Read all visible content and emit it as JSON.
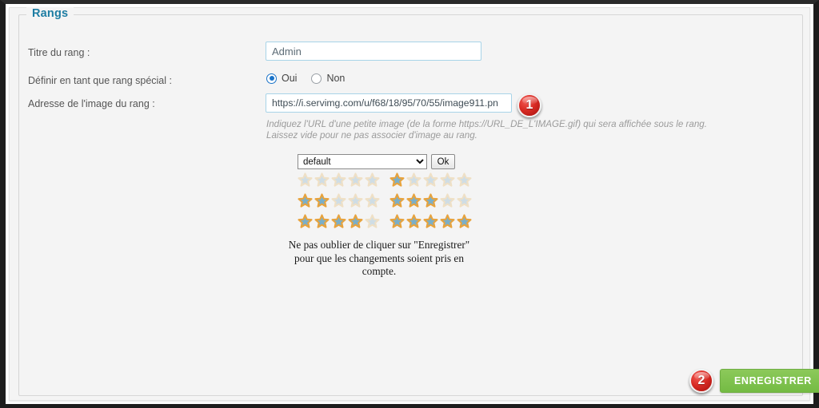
{
  "panel": {
    "legend": "Rangs"
  },
  "fields": {
    "title": {
      "label": "Titre du rang :",
      "value": "Admin",
      "placeholder": ""
    },
    "special": {
      "label": "Définir en tant que rang spécial :",
      "options": [
        {
          "label": "Oui",
          "selected": true
        },
        {
          "label": "Non",
          "selected": false
        }
      ]
    },
    "image": {
      "label": "Adresse de l'image du rang :",
      "value": "https://i.servimg.com/u/f68/18/95/70/55/image911.pn",
      "placeholder": "",
      "hint_line1": "Indiquez l'URL d'une petite image (de la forme https://URL_DE_L'IMAGE.gif) qui sera affichée sous le rang.",
      "hint_line2": "Laissez vide pour ne pas associer d'image au rang."
    }
  },
  "rating_picker": {
    "select_value": "default",
    "select_options": [
      "default"
    ],
    "ok_label": "Ok",
    "max_stars": 5,
    "rows": [
      {
        "filled": 0
      },
      {
        "filled": 1
      },
      {
        "filled": 2
      },
      {
        "filled": 3
      },
      {
        "filled": 4
      },
      {
        "filled": 5
      }
    ],
    "colors": {
      "star_filled_fill": "#7aafc9",
      "star_filled_stroke": "#e8a33d",
      "star_empty_fill": "#cfdde5",
      "star_empty_stroke": "#efe0c6"
    }
  },
  "note": {
    "line1": "Ne pas oublier de cliquer sur \"Enregistrer\"",
    "line2": "pour que les changements soient pris en",
    "line3": "compte."
  },
  "callouts": {
    "one": "1",
    "two": "2"
  },
  "actions": {
    "save_label": "ENREGISTRER",
    "save_color": "#7cc04a"
  }
}
